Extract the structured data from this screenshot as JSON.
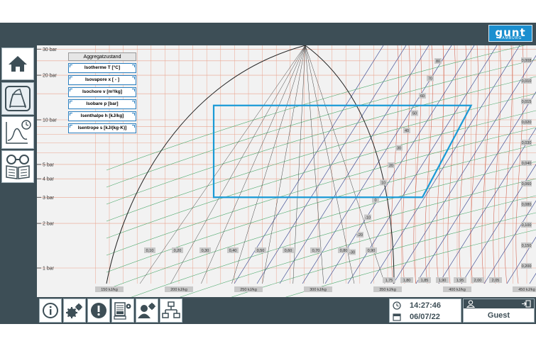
{
  "logo": {
    "text": "gunt",
    "subtext": "HAMBURG"
  },
  "sidebar": {
    "items": [
      {
        "icon": "home-icon"
      },
      {
        "icon": "diagram-icon"
      },
      {
        "icon": "chart-clock-icon"
      },
      {
        "icon": "glasses-book-icon"
      }
    ]
  },
  "legend": {
    "title": "Aggregatzustand",
    "items": [
      "Isotherme T [°C]",
      "Isovapore x [ - ]",
      "Isochore v [m³/kg]",
      "Isobare p [bar]",
      "Isenthalpe h [kJ/kg]",
      "Isentrope s [kJ/(kg·K)]"
    ]
  },
  "chart_data": {
    "type": "line",
    "pressure_labels": [
      {
        "label": "30 bar",
        "p": 30
      },
      {
        "label": "20 bar",
        "p": 20
      },
      {
        "label": "10 bar",
        "p": 10
      },
      {
        "label": "5 bar",
        "p": 5
      },
      {
        "label": "4 bar",
        "p": 4
      },
      {
        "label": "3 bar",
        "p": 3
      },
      {
        "label": "2 bar",
        "p": 2
      },
      {
        "label": "1 bar",
        "p": 1
      }
    ],
    "enthalpy_labels": [
      {
        "label": "150 kJ/kg",
        "h": 150
      },
      {
        "label": "200 kJ/kg",
        "h": 200
      },
      {
        "label": "250 kJ/kg",
        "h": 250
      },
      {
        "label": "300 kJ/kg",
        "h": 300
      },
      {
        "label": "350 kJ/kg",
        "h": 350
      },
      {
        "label": "400 kJ/kg",
        "h": 400
      },
      {
        "label": "450 kJ/kg",
        "h": 450
      }
    ],
    "quality_labels": [
      "0,10",
      "0,20",
      "0,30",
      "0,40",
      "0,50",
      "0,60",
      "0,70",
      "0,80",
      "0,90"
    ],
    "entropy_labels": [
      "1,75",
      "1,80",
      "1,85",
      "1,90",
      "1,95",
      "2,00",
      "2,05"
    ],
    "isotherm_labels": [
      "80",
      "70",
      "60",
      "50",
      "40",
      "30",
      "20",
      "10",
      "0",
      "-10",
      "-20",
      "-30"
    ],
    "isochore_labels": [
      "0,008",
      "0,010",
      "0,015",
      "0,020",
      "0,030",
      "0,040",
      "0,060",
      "0,080",
      "0,100",
      "0,150",
      "0,200"
    ],
    "cycle": {
      "points": [
        {
          "h": 225,
          "p": 12.5
        },
        {
          "h": 410,
          "p": 12.5
        },
        {
          "h": 375,
          "p": 3.0
        },
        {
          "h": 225,
          "p": 3.0
        }
      ],
      "color": "#1a9ad6"
    }
  },
  "datetime": {
    "time": "14:27:46",
    "date": "06/07/22"
  },
  "user": {
    "name": "Guest"
  },
  "toolbar": {
    "icons": [
      "info-icon",
      "settings-icon",
      "alert-icon",
      "data-logger-icon",
      "user-settings-icon",
      "network-icon"
    ]
  }
}
